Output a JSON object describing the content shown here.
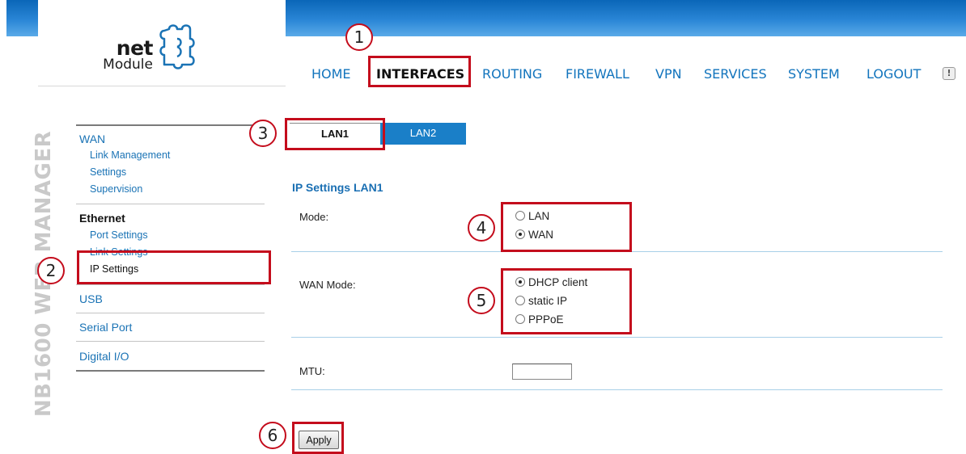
{
  "brand": {
    "line1": "net",
    "line2": "Module"
  },
  "nav": {
    "items": [
      "HOME",
      "INTERFACES",
      "ROUTING",
      "FIREWALL",
      "VPN",
      "SERVICES",
      "SYSTEM",
      "LOGOUT"
    ],
    "active": "INTERFACES",
    "alert_glyph": "!"
  },
  "vertical_title": "NB1600 WEB MANAGER",
  "sidebar": {
    "wan": "WAN",
    "wan_items": [
      "Link Management",
      "Settings",
      "Supervision"
    ],
    "ethernet": "Ethernet",
    "ethernet_items": [
      "Port Settings",
      "Link Settings",
      "IP Settings"
    ],
    "ethernet_selected": "IP Settings",
    "bottom_items": [
      "USB",
      "Serial Port",
      "Digital I/O"
    ]
  },
  "tabs": [
    "LAN1",
    "LAN2"
  ],
  "active_tab": "LAN1",
  "section_title": "IP Settings LAN1",
  "form": {
    "mode_label": "Mode:",
    "mode_options": [
      "LAN",
      "WAN"
    ],
    "mode_selected": "WAN",
    "wan_mode_label": "WAN Mode:",
    "wan_mode_options": [
      "DHCP client",
      "static IP",
      "PPPoE"
    ],
    "wan_mode_selected": "DHCP client",
    "mtu_label": "MTU:",
    "mtu_value": ""
  },
  "apply_label": "Apply",
  "callouts": [
    "1",
    "2",
    "3",
    "4",
    "5",
    "6"
  ],
  "colors": {
    "accent_blue": "#1a7fc8",
    "link_blue": "#1274bd",
    "callout_red": "#c40c1c"
  },
  "icons": {
    "logo": "puzzle-piece-icon",
    "alert": "exclamation-icon"
  }
}
